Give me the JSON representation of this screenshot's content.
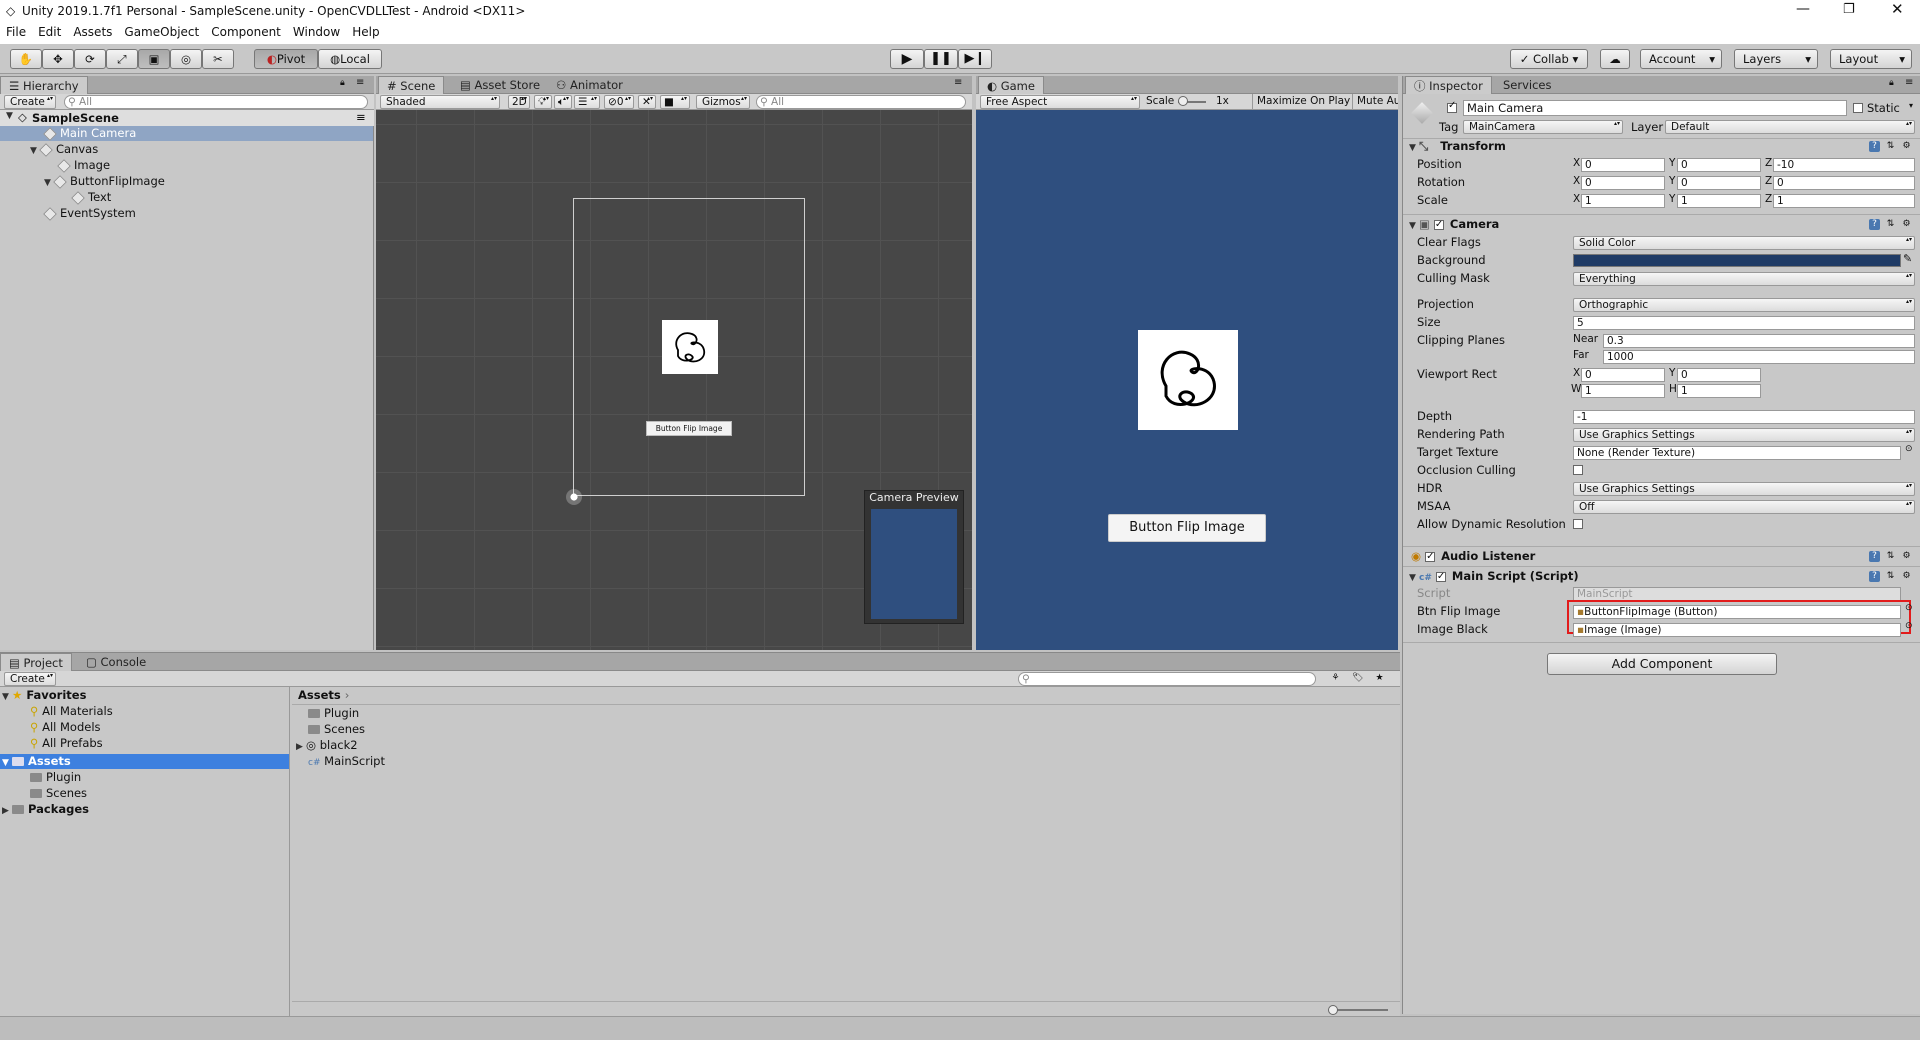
{
  "window": {
    "title": "Unity 2019.1.7f1 Personal - SampleScene.unity - OpenCVDLLTest - Android <DX11>"
  },
  "menu": [
    "File",
    "Edit",
    "Assets",
    "GameObject",
    "Component",
    "Window",
    "Help"
  ],
  "toolbar": {
    "pivot": "Pivot",
    "local": "Local",
    "collab": "Collab",
    "account": "Account",
    "layers": "Layers",
    "layout": "Layout"
  },
  "hierarchy": {
    "tab": "Hierarchy",
    "create": "Create",
    "search_placeholder": "All",
    "scene": "SampleScene",
    "items": [
      "Main Camera",
      "Canvas",
      "Image",
      "ButtonFlipImage",
      "Text",
      "EventSystem"
    ]
  },
  "scene_view": {
    "tabs": [
      "Scene",
      "Asset Store",
      "Animator"
    ],
    "shading": "Shaded",
    "mode_2d": "2D",
    "fx_count": "0",
    "gizmos": "Gizmos",
    "search_placeholder": "All",
    "button_label": "Button Flip Image",
    "camera_preview": "Camera Preview"
  },
  "game_view": {
    "tab": "Game",
    "aspect": "Free Aspect",
    "scale_label": "Scale",
    "scale_value": "1x",
    "maximize": "Maximize On Play",
    "mute": "Mute Audio",
    "button_label": "Button Flip Image",
    "bg_color": "#2f4f7f"
  },
  "inspector": {
    "tabs": [
      "Inspector",
      "Services"
    ],
    "object_name": "Main Camera",
    "static_label": "Static",
    "tag_label": "Tag",
    "tag_value": "MainCamera",
    "layer_label": "Layer",
    "layer_value": "Default",
    "transform": {
      "title": "Transform",
      "position": {
        "label": "Position",
        "x": "0",
        "y": "0",
        "z": "-10"
      },
      "rotation": {
        "label": "Rotation",
        "x": "0",
        "y": "0",
        "z": "0"
      },
      "scale": {
        "label": "Scale",
        "x": "1",
        "y": "1",
        "z": "1"
      }
    },
    "camera": {
      "title": "Camera",
      "clear_flags": {
        "label": "Clear Flags",
        "value": "Solid Color"
      },
      "background": {
        "label": "Background",
        "color": "#1f3b66"
      },
      "culling_mask": {
        "label": "Culling Mask",
        "value": "Everything"
      },
      "projection": {
        "label": "Projection",
        "value": "Orthographic"
      },
      "size": {
        "label": "Size",
        "value": "5"
      },
      "clipping": {
        "label": "Clipping Planes",
        "near_label": "Near",
        "near": "0.3",
        "far_label": "Far",
        "far": "1000"
      },
      "viewport": {
        "label": "Viewport Rect",
        "x": "0",
        "y": "0",
        "w": "1",
        "h": "1"
      },
      "depth": {
        "label": "Depth",
        "value": "-1"
      },
      "rendering_path": {
        "label": "Rendering Path",
        "value": "Use Graphics Settings"
      },
      "target_texture": {
        "label": "Target Texture",
        "value": "None (Render Texture)"
      },
      "occlusion": {
        "label": "Occlusion Culling"
      },
      "hdr": {
        "label": "HDR",
        "value": "Use Graphics Settings"
      },
      "msaa": {
        "label": "MSAA",
        "value": "Off"
      },
      "dynamic_res": {
        "label": "Allow Dynamic Resolution"
      }
    },
    "audio_listener": "Audio Listener",
    "main_script": {
      "title": "Main Script (Script)",
      "script": {
        "label": "Script",
        "value": "MainScript"
      },
      "btn_flip": {
        "label": "Btn Flip Image",
        "value": "ButtonFlipImage (Button)"
      },
      "image_black": {
        "label": "Image Black",
        "value": "Image (Image)"
      }
    },
    "add_component": "Add Component"
  },
  "project": {
    "tabs": [
      "Project",
      "Console"
    ],
    "create": "Create",
    "favorites": "Favorites",
    "favorite_items": [
      "All Materials",
      "All Models",
      "All Prefabs"
    ],
    "assets": "Assets",
    "asset_folders": [
      "Plugin",
      "Scenes"
    ],
    "packages": "Packages",
    "breadcrumb": "Assets",
    "contents": [
      "Plugin",
      "Scenes",
      "black2",
      "MainScript"
    ]
  }
}
